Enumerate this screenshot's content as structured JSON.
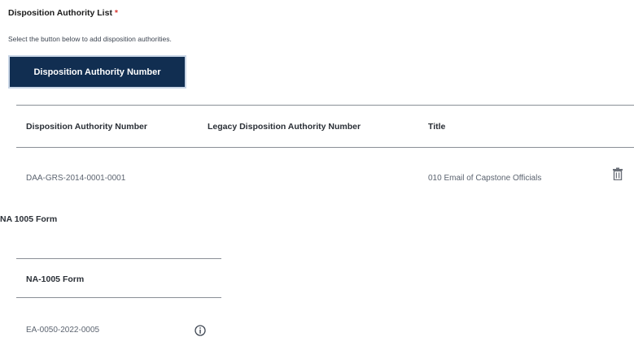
{
  "disposition": {
    "title": "Disposition Authority List",
    "required_marker": "*",
    "helper_text": "Select the button below to add disposition authorities.",
    "add_button_label": "Disposition Authority Number",
    "table": {
      "columns": [
        "Disposition Authority Number",
        "Legacy Disposition Authority Number",
        "Title"
      ],
      "rows": [
        {
          "number": "DAA-GRS-2014-0001-0001",
          "legacy": "",
          "title": "010 Email of Capstone Officials"
        }
      ]
    }
  },
  "na_form": {
    "title": "NA 1005 Form",
    "table": {
      "columns": [
        "NA-1005 Form"
      ],
      "rows": [
        {
          "form": "EA-0050-2022-0005"
        }
      ]
    }
  },
  "icons": {
    "delete": "trash-icon",
    "info": "info-icon"
  },
  "colors": {
    "primary_button": "#112e51",
    "required": "#d83933"
  }
}
